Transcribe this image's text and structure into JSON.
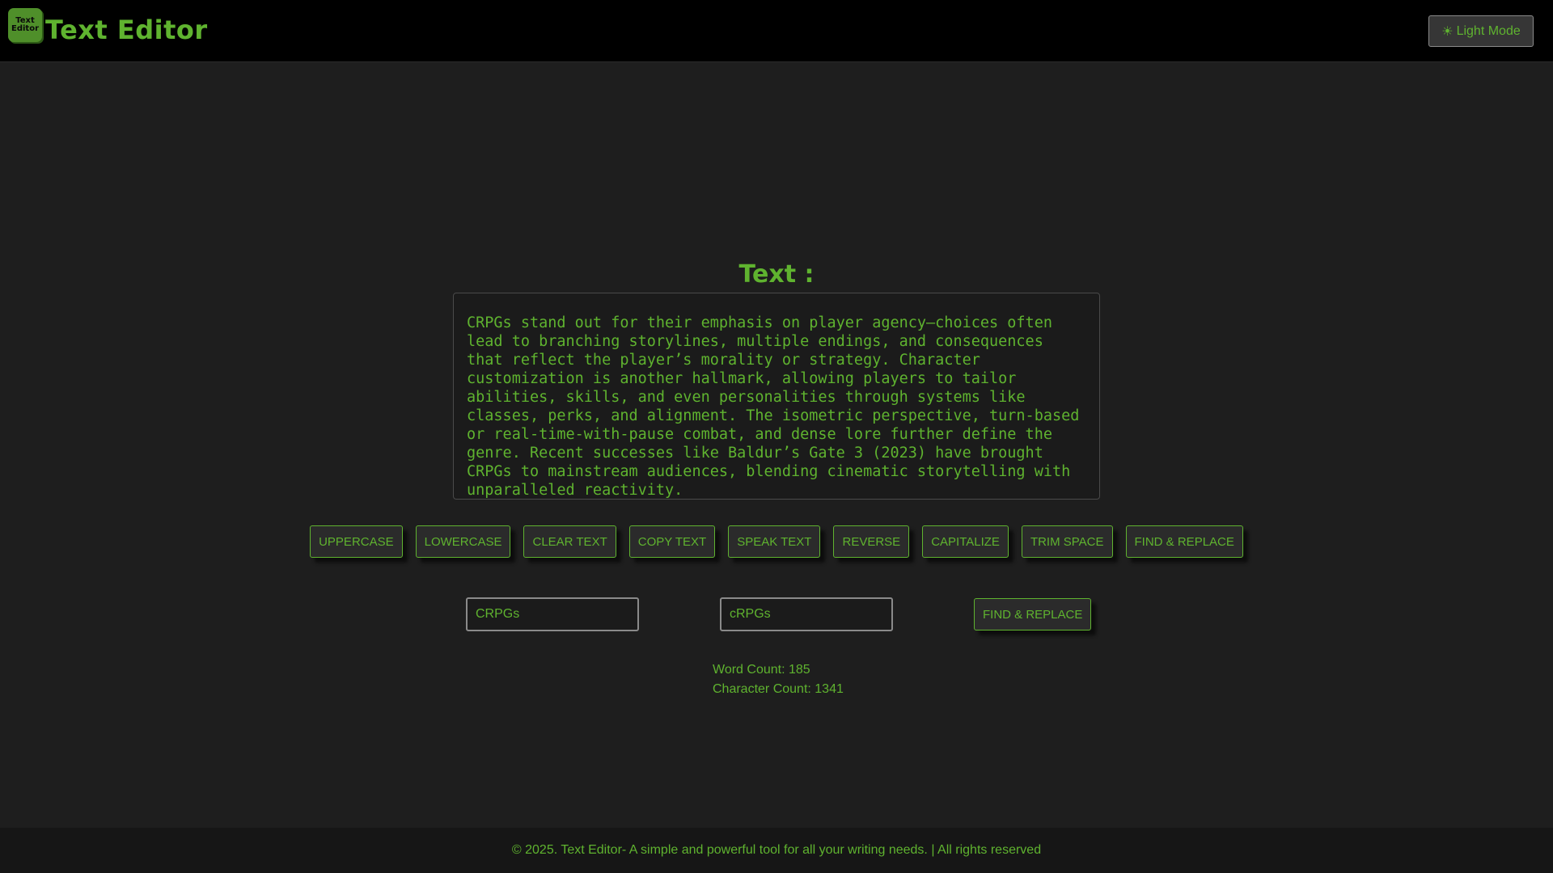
{
  "header": {
    "logo_line1": "Text",
    "logo_line2": "Editor",
    "title": "Text Editor",
    "mode_button_icon": "☀",
    "mode_button_label": "Light Mode"
  },
  "main": {
    "section_title": "Text :",
    "editor_text": "CRPGs stand out for their emphasis on player agency—choices often lead to branching storylines, multiple endings, and consequences that reflect the player’s morality or strategy. Character customization is another hallmark, allowing players to tailor abilities, skills, and even personalities through systems like classes, perks, and alignment. The isometric perspective, turn-based or real-time-with-pause combat, and dense lore further define the genre. Recent successes like Baldur’s Gate 3 (2023) have brought CRPGs to mainstream audiences, blending cinematic storytelling with unparalleled reactivity."
  },
  "toolbar": {
    "buttons": [
      {
        "label": "UPPERCASE"
      },
      {
        "label": "LOWERCASE"
      },
      {
        "label": "CLEAR TEXT"
      },
      {
        "label": "COPY TEXT"
      },
      {
        "label": "SPEAK TEXT"
      },
      {
        "label": "REVERSE"
      },
      {
        "label": "CAPITALIZE"
      },
      {
        "label": "TRIM SPACE"
      },
      {
        "label": "FIND & REPLACE"
      }
    ]
  },
  "find_replace": {
    "find_value": "CRPGs",
    "replace_value": "cRPGs",
    "button_label": "FIND & REPLACE"
  },
  "stats": {
    "word_count": "Word Count: 185",
    "char_count": "Character Count: 1341"
  },
  "footer": {
    "text": "© 2025. Text Editor- A simple and powerful tool for all your writing needs. | All rights reserved"
  },
  "colors": {
    "accent": "#5fb32f",
    "background": "#1e1e1e",
    "header_bg": "#000000"
  }
}
